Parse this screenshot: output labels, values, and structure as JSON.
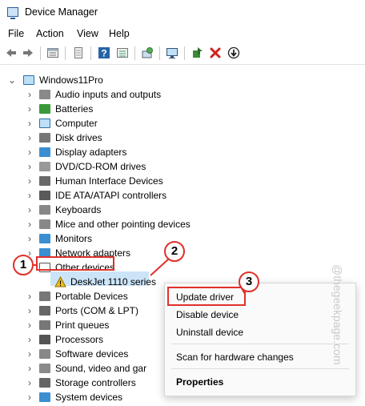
{
  "window": {
    "title": "Device Manager"
  },
  "menu": [
    "File",
    "Action",
    "View",
    "Help"
  ],
  "toolbar_icons": [
    "back-arrow-icon",
    "forward-arrow-icon",
    "properties-icon",
    "document-icon",
    "help-icon",
    "list-icon",
    "scan-icon",
    "monitor-icon",
    "update-driver-icon",
    "uninstall-x-icon",
    "disable-icon"
  ],
  "tree": {
    "root": "Windows11Pro",
    "items": [
      "Audio inputs and outputs",
      "Batteries",
      "Computer",
      "Disk drives",
      "Display adapters",
      "DVD/CD-ROM drives",
      "Human Interface Devices",
      "IDE ATA/ATAPI controllers",
      "Keyboards",
      "Mice and other pointing devices",
      "Monitors",
      "Network adapters",
      "Other devices",
      "DeskJet 1110 series",
      "Portable Devices",
      "Ports (COM & LPT)",
      "Print queues",
      "Processors",
      "Software devices",
      "Sound, video and gar",
      "Storage controllers",
      "System devices"
    ]
  },
  "context_menu": {
    "update": "Update driver",
    "disable": "Disable device",
    "uninstall": "Uninstall device",
    "scan": "Scan for hardware changes",
    "properties": "Properties"
  },
  "badges": [
    "1",
    "2",
    "3"
  ],
  "watermark": "@thegeekpage.com",
  "colors": {
    "highlight": "#e0302b",
    "selection": "#cce4f7"
  }
}
